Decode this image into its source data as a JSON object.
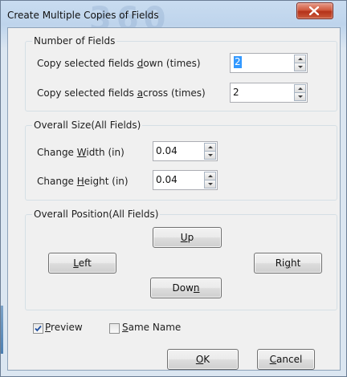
{
  "window": {
    "title": "Create Multiple Copies of Fields",
    "watermark": "360"
  },
  "number_of_fields": {
    "legend": "Number of Fields",
    "down": {
      "label_pre": "Copy selected fields ",
      "label_key": "d",
      "label_post": "own (times)",
      "value": "2"
    },
    "across": {
      "label_pre": "Copy selected fields ",
      "label_key": "a",
      "label_post": "cross (times)",
      "value": "2"
    }
  },
  "overall_size": {
    "legend": "Overall Size(All Fields)",
    "width": {
      "label_pre": "Change ",
      "label_key": "W",
      "label_post": "idth (in)",
      "value": "0.04"
    },
    "height": {
      "label_pre": "Change ",
      "label_key": "H",
      "label_post": "eight (in)",
      "value": "0.04"
    }
  },
  "overall_position": {
    "legend": "Overall Position(All Fields)",
    "up": {
      "pre": "",
      "key": "U",
      "post": "p"
    },
    "left": {
      "pre": "",
      "key": "L",
      "post": "eft"
    },
    "right": {
      "pre": "Ri",
      "key": "g",
      "post": "ht"
    },
    "down": {
      "pre": "Dow",
      "key": "n",
      "post": ""
    }
  },
  "options": {
    "preview": {
      "pre": "",
      "key": "P",
      "post": "review",
      "checked": true
    },
    "same_name": {
      "pre": "",
      "key": "S",
      "post": "ame Name",
      "checked": false
    }
  },
  "buttons": {
    "ok": {
      "pre": "",
      "key": "O",
      "post": "K"
    },
    "cancel": {
      "pre": "",
      "key": "C",
      "post": "ancel"
    }
  },
  "colors": {
    "selection": "#3399ff",
    "close_button": "#c9462c",
    "titlebar": "#c9dcf0"
  }
}
